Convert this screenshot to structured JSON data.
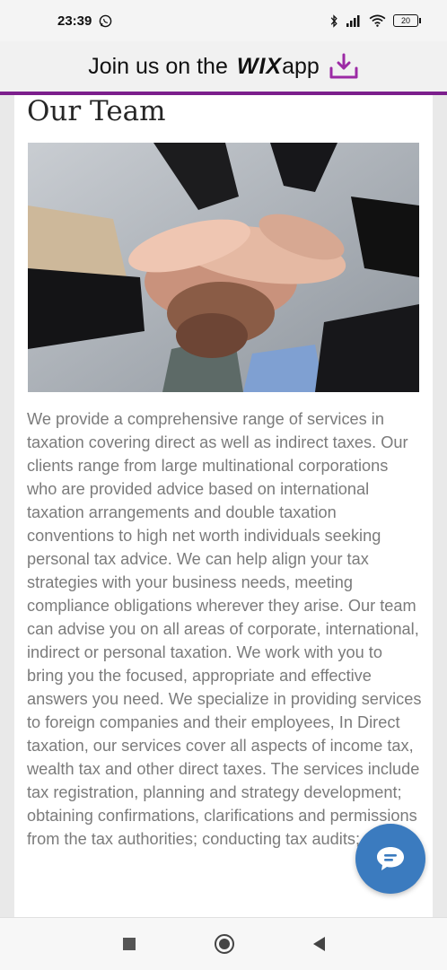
{
  "status_bar": {
    "time": "23:39",
    "battery": "20",
    "icons": [
      "whatsapp-icon",
      "bluetooth-icon",
      "signal-icon",
      "wifi-icon",
      "battery-icon"
    ]
  },
  "banner": {
    "prefix": "Join us on the",
    "logo": "WIX",
    "suffix": "app",
    "icon": "download-icon",
    "accent_color": "#7c1f8c"
  },
  "page": {
    "title": "Our Team",
    "image_icon": "team-hands-image",
    "body": "We provide a comprehensive range of services in taxation covering direct as well as indirect taxes. Our clients range from large multinational corporations who are provided advice based on international taxation arrangements and double taxation conventions to high net worth individuals seeking personal tax advice. We can help align your tax strategies with your business needs, meeting compliance obligations wherever they arise. Our team can advise you on all areas of corporate, international, indirect or personal taxation. We work with you to bring you the focused, appropriate and effective answers you need. We specialize in providing services to foreign companies and their employees, In Direct taxation, our services cover all aspects of income tax, wealth tax and other direct taxes. The services include tax registration, planning and strategy development; obtaining confirmations, clarifications and permissions from the tax authorities; conducting tax audits;"
  },
  "chat_button": {
    "icon": "chat-bubble-icon",
    "color": "#3b7bbf"
  },
  "nav_bar": {
    "icons": [
      "recents-square-icon",
      "home-circle-icon",
      "back-triangle-icon"
    ]
  }
}
